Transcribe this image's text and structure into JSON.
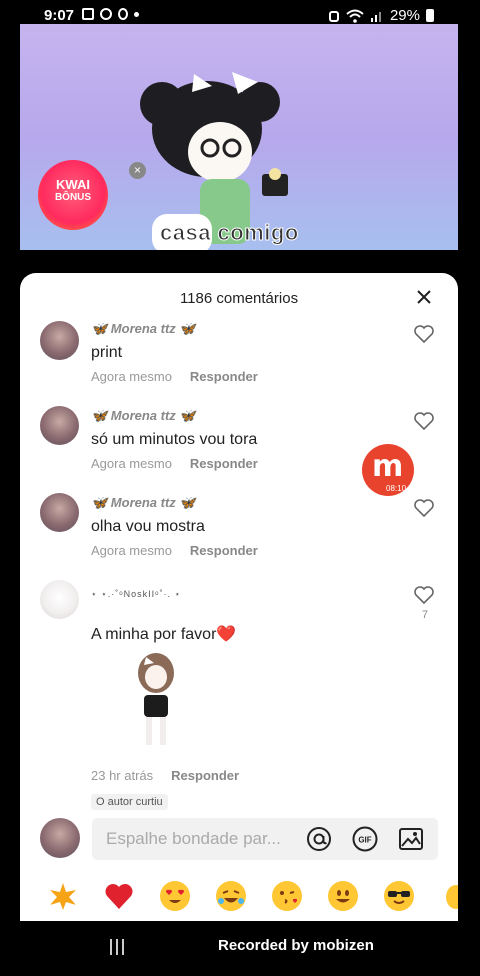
{
  "status_bar": {
    "time": "9:07",
    "battery": "29%"
  },
  "video": {
    "caption": "casa comigo",
    "ad_badge": {
      "line1": "KWAI",
      "line2": "BÔNUS"
    },
    "close_ad": "×"
  },
  "sheet": {
    "title": "1186 comentários",
    "comments": [
      {
        "username": "🦋 Morena ttz 🦋",
        "text": "print",
        "time": "Agora mesmo",
        "reply": "Responder"
      },
      {
        "username": "🦋 Morena ttz 🦋",
        "text": "só um minutos vou tora",
        "time": "Agora mesmo",
        "reply": "Responder"
      },
      {
        "username": "🦋 Morena ttz 🦋",
        "text": "olha vou mostra",
        "time": "Agora mesmo",
        "reply": "Responder"
      },
      {
        "username": "⋆ ⋆.·˚ᵒNoskIIᵒ˚·. ⋆",
        "text": "A minha por favor❤️",
        "time": "23 hr atrás",
        "reply": "Responder",
        "likes": "7",
        "liked_by_author": "O autor curtiu"
      }
    ],
    "input": {
      "placeholder": "Espalhe bondade par..."
    },
    "emojis": [
      "burst",
      "heart",
      "heart-eyes",
      "laughing",
      "kiss",
      "smile",
      "sunglasses",
      "wave"
    ]
  },
  "overlay": {
    "mobizen_letter": "m",
    "mobizen_timer": "08:10",
    "recorded_by": "Recorded by mobizen"
  },
  "colors": {
    "accent_red": "#e8442d",
    "heart_red": "#e0222f",
    "emoji_yellow": "#ffc734"
  }
}
